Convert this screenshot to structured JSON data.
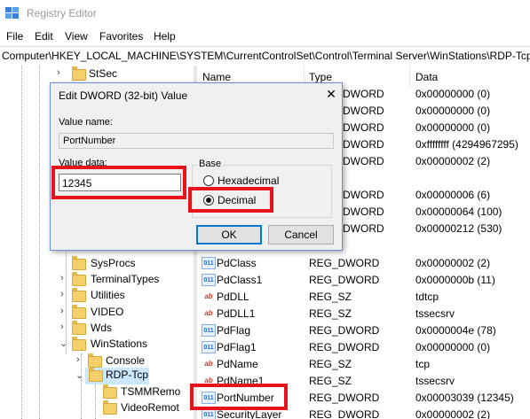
{
  "window": {
    "title": "Registry Editor",
    "app_icon": "registry-editor-icon"
  },
  "menu": [
    "File",
    "Edit",
    "View",
    "Favorites",
    "Help"
  ],
  "address": "Computer\\HKEY_LOCAL_MACHINE\\SYSTEM\\CurrentControlSet\\Control\\Terminal Server\\WinStations\\RDP-Tcp",
  "tree": {
    "top_item": "StSec",
    "items": [
      {
        "label": "SysProcs"
      },
      {
        "label": "TerminalTypes"
      },
      {
        "label": "Utilities"
      },
      {
        "label": "VIDEO"
      },
      {
        "label": "Wds"
      },
      {
        "label": "WinStations"
      },
      {
        "label": "Console"
      },
      {
        "label": "RDP-Tcp"
      },
      {
        "label": "TSMMRemo"
      },
      {
        "label": "VideoRemot"
      }
    ]
  },
  "list": {
    "columns": {
      "name": "Name",
      "type": "Type",
      "data": "Data"
    },
    "rows_behind_dialog": [
      {
        "type": "DWORD",
        "data": "0x00000000 (0)"
      },
      {
        "type": "DWORD",
        "data": "0x00000000 (0)"
      },
      {
        "type": "DWORD",
        "data": "0x00000000 (0)"
      },
      {
        "type": "DWORD",
        "data": "0xffffffff (4294967295)"
      },
      {
        "type": "DWORD",
        "data": "0x00000002 (2)"
      },
      {
        "type": "",
        "data": ""
      },
      {
        "type": "DWORD",
        "data": "0x00000006 (6)"
      },
      {
        "type": "DWORD",
        "data": "0x00000064 (100)"
      },
      {
        "type": "DWORD",
        "data": "0x00000212 (530)"
      }
    ],
    "rows": [
      {
        "icon": "binary-value-icon",
        "name": "PdClass",
        "type": "REG_DWORD",
        "data": "0x00000002 (2)"
      },
      {
        "icon": "binary-value-icon",
        "name": "PdClass1",
        "type": "REG_DWORD",
        "data": "0x0000000b (11)"
      },
      {
        "icon": "string-value-icon",
        "name": "PdDLL",
        "type": "REG_SZ",
        "data": "tdtcp"
      },
      {
        "icon": "string-value-icon",
        "name": "PdDLL1",
        "type": "REG_SZ",
        "data": "tssecsrv"
      },
      {
        "icon": "binary-value-icon",
        "name": "PdFlag",
        "type": "REG_DWORD",
        "data": "0x0000004e (78)"
      },
      {
        "icon": "binary-value-icon",
        "name": "PdFlag1",
        "type": "REG_DWORD",
        "data": "0x00000000 (0)"
      },
      {
        "icon": "string-value-icon",
        "name": "PdName",
        "type": "REG_SZ",
        "data": "tcp"
      },
      {
        "icon": "string-value-icon",
        "name": "PdName1",
        "type": "REG_SZ",
        "data": "tssecsrv"
      },
      {
        "icon": "binary-value-icon",
        "name": "PortNumber",
        "type": "REG_DWORD",
        "data": "0x00003039 (12345)"
      },
      {
        "icon": "binary-value-icon",
        "name": "SecurityLayer",
        "type": "REG_DWORD",
        "data": "0x00000002 (2)"
      }
    ]
  },
  "dialog": {
    "title": "Edit DWORD (32-bit) Value",
    "value_name_label": "Value name:",
    "value_name": "PortNumber",
    "value_data_label": "Value data:",
    "value_data": "12345",
    "base_label": "Base",
    "hex_label": "Hexadecimal",
    "decimal_label": "Decimal",
    "selected_base": "Decimal",
    "ok_label": "OK",
    "cancel_label": "Cancel",
    "close_glyph": "✕"
  },
  "colors": {
    "highlight": "#e8121b",
    "selection": "#cce8ff",
    "dialog_border": "#6b8fd4"
  }
}
